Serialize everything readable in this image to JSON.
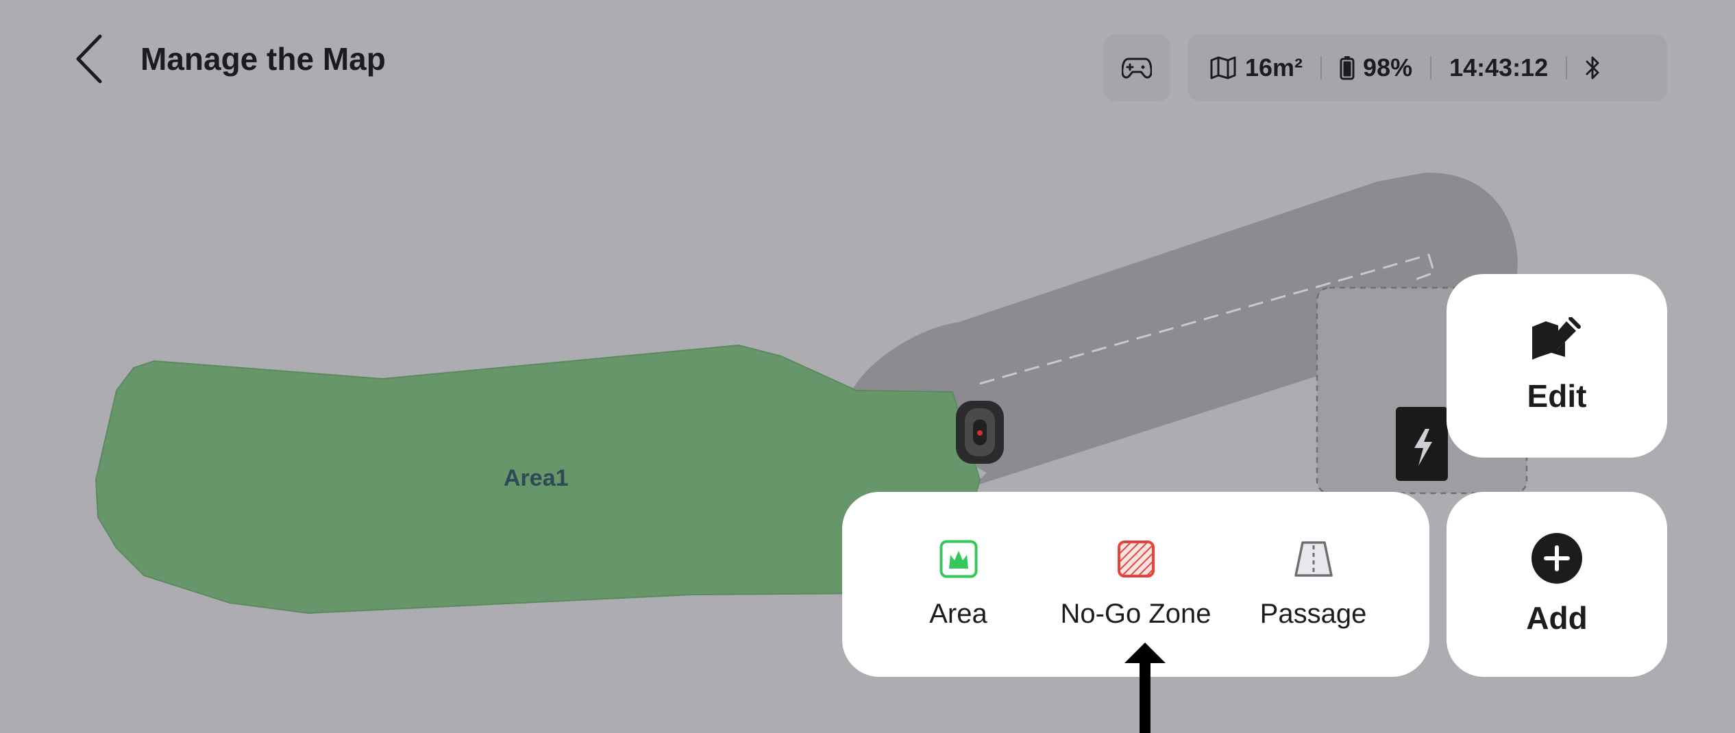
{
  "header": {
    "title": "Manage the Map"
  },
  "status": {
    "area": "16m²",
    "battery": "98%",
    "time": "14:43:12"
  },
  "map": {
    "area_label": "Area1",
    "area_color": "#66966A",
    "path_color": "#8C8B8F",
    "dock_color": "#1a1a1a"
  },
  "actions": {
    "edit_label": "Edit",
    "add_label": "Add"
  },
  "add_menu": {
    "items": [
      {
        "label": "Area",
        "icon": "area-grass-icon",
        "color": "#34C759"
      },
      {
        "label": "No-Go Zone",
        "icon": "no-go-zone-icon",
        "color": "#E5443A"
      },
      {
        "label": "Passage",
        "icon": "passage-icon",
        "color": "#8E8E93"
      }
    ]
  }
}
